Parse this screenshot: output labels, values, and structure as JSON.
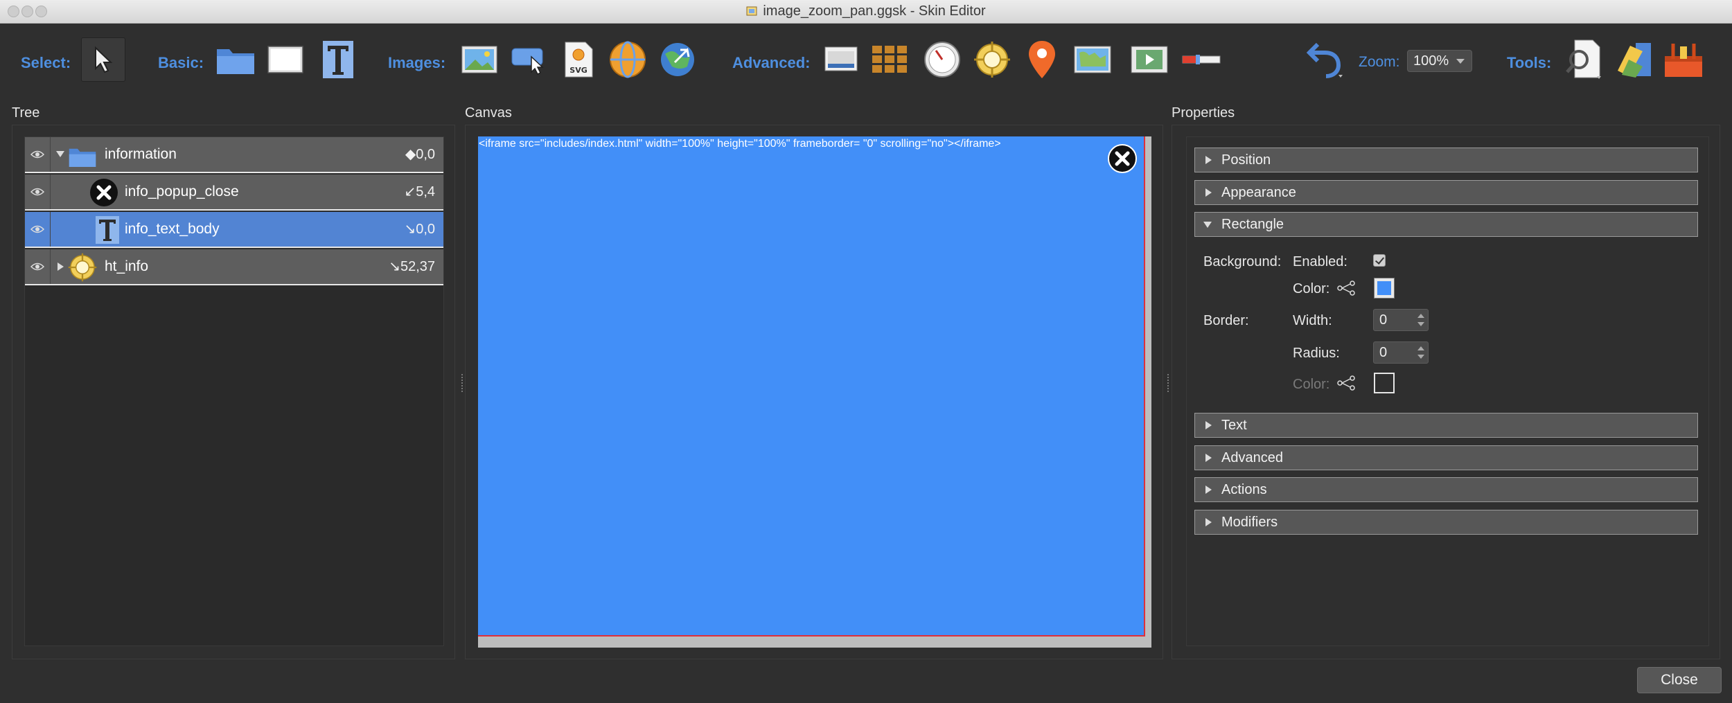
{
  "window": {
    "title": "image_zoom_pan.ggsk - Skin Editor"
  },
  "toolbar": {
    "select_label": "Select:",
    "basic_label": "Basic:",
    "images_label": "Images:",
    "advanced_label": "Advanced:",
    "zoom_label": "Zoom:",
    "zoom_value": "100%",
    "tools_label": "Tools:"
  },
  "panels": {
    "tree": "Tree",
    "canvas": "Canvas",
    "properties": "Properties"
  },
  "tree": {
    "rows": [
      {
        "name": "information",
        "coord": "◆0,0"
      },
      {
        "name": "info_popup_close",
        "coord": "↙5,4"
      },
      {
        "name": "info_text_body",
        "coord": "↘0,0"
      },
      {
        "name": "ht_info",
        "coord": "↘52,37"
      }
    ]
  },
  "canvas": {
    "code_text": "<iframe src=\"includes/index.html\" width=\"100%\" height=\"100%\" frameborder= \"0\" scrolling=\"no\"></iframe>",
    "fill_color": "#428ff8"
  },
  "properties": {
    "sections": {
      "position": "Position",
      "appearance": "Appearance",
      "rectangle": "Rectangle",
      "text": "Text",
      "advanced": "Advanced",
      "actions": "Actions",
      "modifiers": "Modifiers"
    },
    "rectangle": {
      "background_label": "Background:",
      "enabled_label": "Enabled:",
      "enabled_checked": true,
      "color_label": "Color:",
      "background_color": "#428ff8",
      "border_label": "Border:",
      "width_label": "Width:",
      "width_value": "0",
      "radius_label": "Radius:",
      "radius_value": "0",
      "border_color_label": "Color:",
      "border_color": "#ffffff"
    }
  },
  "footer": {
    "close_label": "Close"
  },
  "colors": {
    "accent": "#4e8fe0",
    "selection": "#5284d3",
    "border_red": "#e0303a"
  }
}
